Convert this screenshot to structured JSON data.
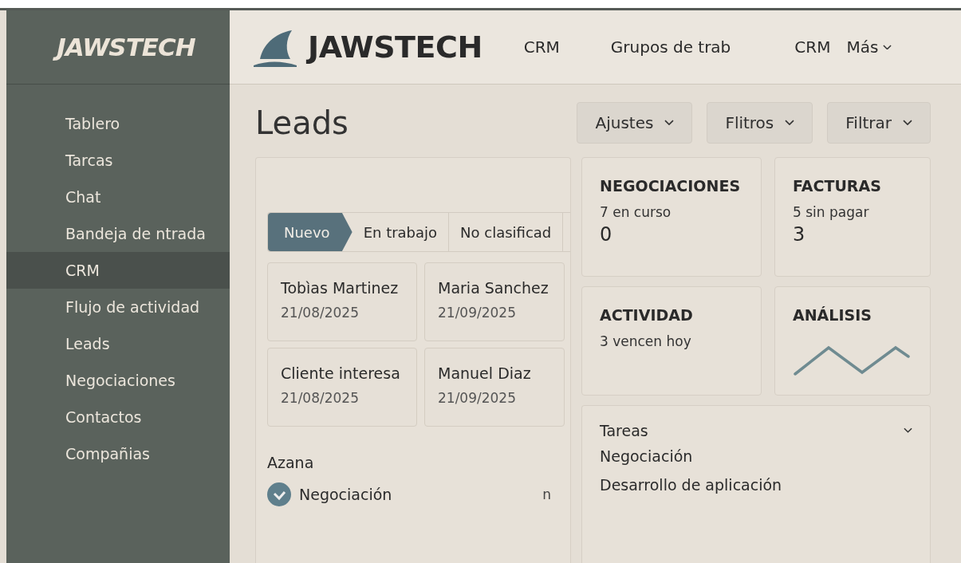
{
  "sidebar": {
    "logo": "JAWSTECH",
    "items": [
      {
        "label": "Tablero",
        "selected": false
      },
      {
        "label": "Tarcas",
        "selected": false
      },
      {
        "label": "Chat",
        "selected": false
      },
      {
        "label": "Bandeja de ntrada",
        "selected": false
      },
      {
        "label": "CRM",
        "selected": true
      },
      {
        "label": "Flujo de actividad",
        "selected": false
      },
      {
        "label": "Leads",
        "selected": false
      },
      {
        "label": "Negociaciones",
        "selected": false
      },
      {
        "label": "Contactos",
        "selected": false
      },
      {
        "label": "Compañias",
        "selected": false
      }
    ]
  },
  "header": {
    "brand": "JAWSTECH",
    "nav": [
      {
        "label": "CRM",
        "dropdown": false
      },
      {
        "label": "Grupos de trab",
        "dropdown": false
      },
      {
        "label": "CRM",
        "dropdown": false
      },
      {
        "label": "Más",
        "dropdown": true
      }
    ]
  },
  "page": {
    "title": "Leads",
    "buttons": [
      "Ajustes",
      "Flitros",
      "Filtrar"
    ]
  },
  "leads_panel": {
    "stages": [
      {
        "label": "Nuevo",
        "selected": true
      },
      {
        "label": "En trabajo",
        "selected": false
      },
      {
        "label": "No clasificad",
        "selected": false
      }
    ],
    "cards": [
      {
        "name": "Tobìas Martinez",
        "date": "21/08/2025"
      },
      {
        "name": "Maria Sanchez",
        "date": "21/09/2025"
      },
      {
        "name": "Cliente interesa",
        "date": "21/08/2025"
      },
      {
        "name": "Manuel Diaz",
        "date": "21/09/2025"
      }
    ],
    "section": "Azana",
    "tasks": [
      {
        "label": "Negociación",
        "checked": true,
        "note": "n"
      }
    ]
  },
  "stats": [
    {
      "kind": "count",
      "title": "NEGOCIACIONES",
      "subtitle": "7 en curso",
      "value": "0"
    },
    {
      "kind": "count",
      "title": "FACTURAS",
      "subtitle": "5 sin pagar",
      "value": "3"
    },
    {
      "kind": "count",
      "title": "ACTIVIDAD",
      "subtitle": "3 vencen hoy"
    },
    {
      "kind": "sparkline",
      "title": "ANÁLISIS"
    }
  ],
  "tareas": {
    "title": "Tareas",
    "expanded": true,
    "items": [
      "Negociación",
      "Desarrollo de aplicación"
    ]
  }
}
